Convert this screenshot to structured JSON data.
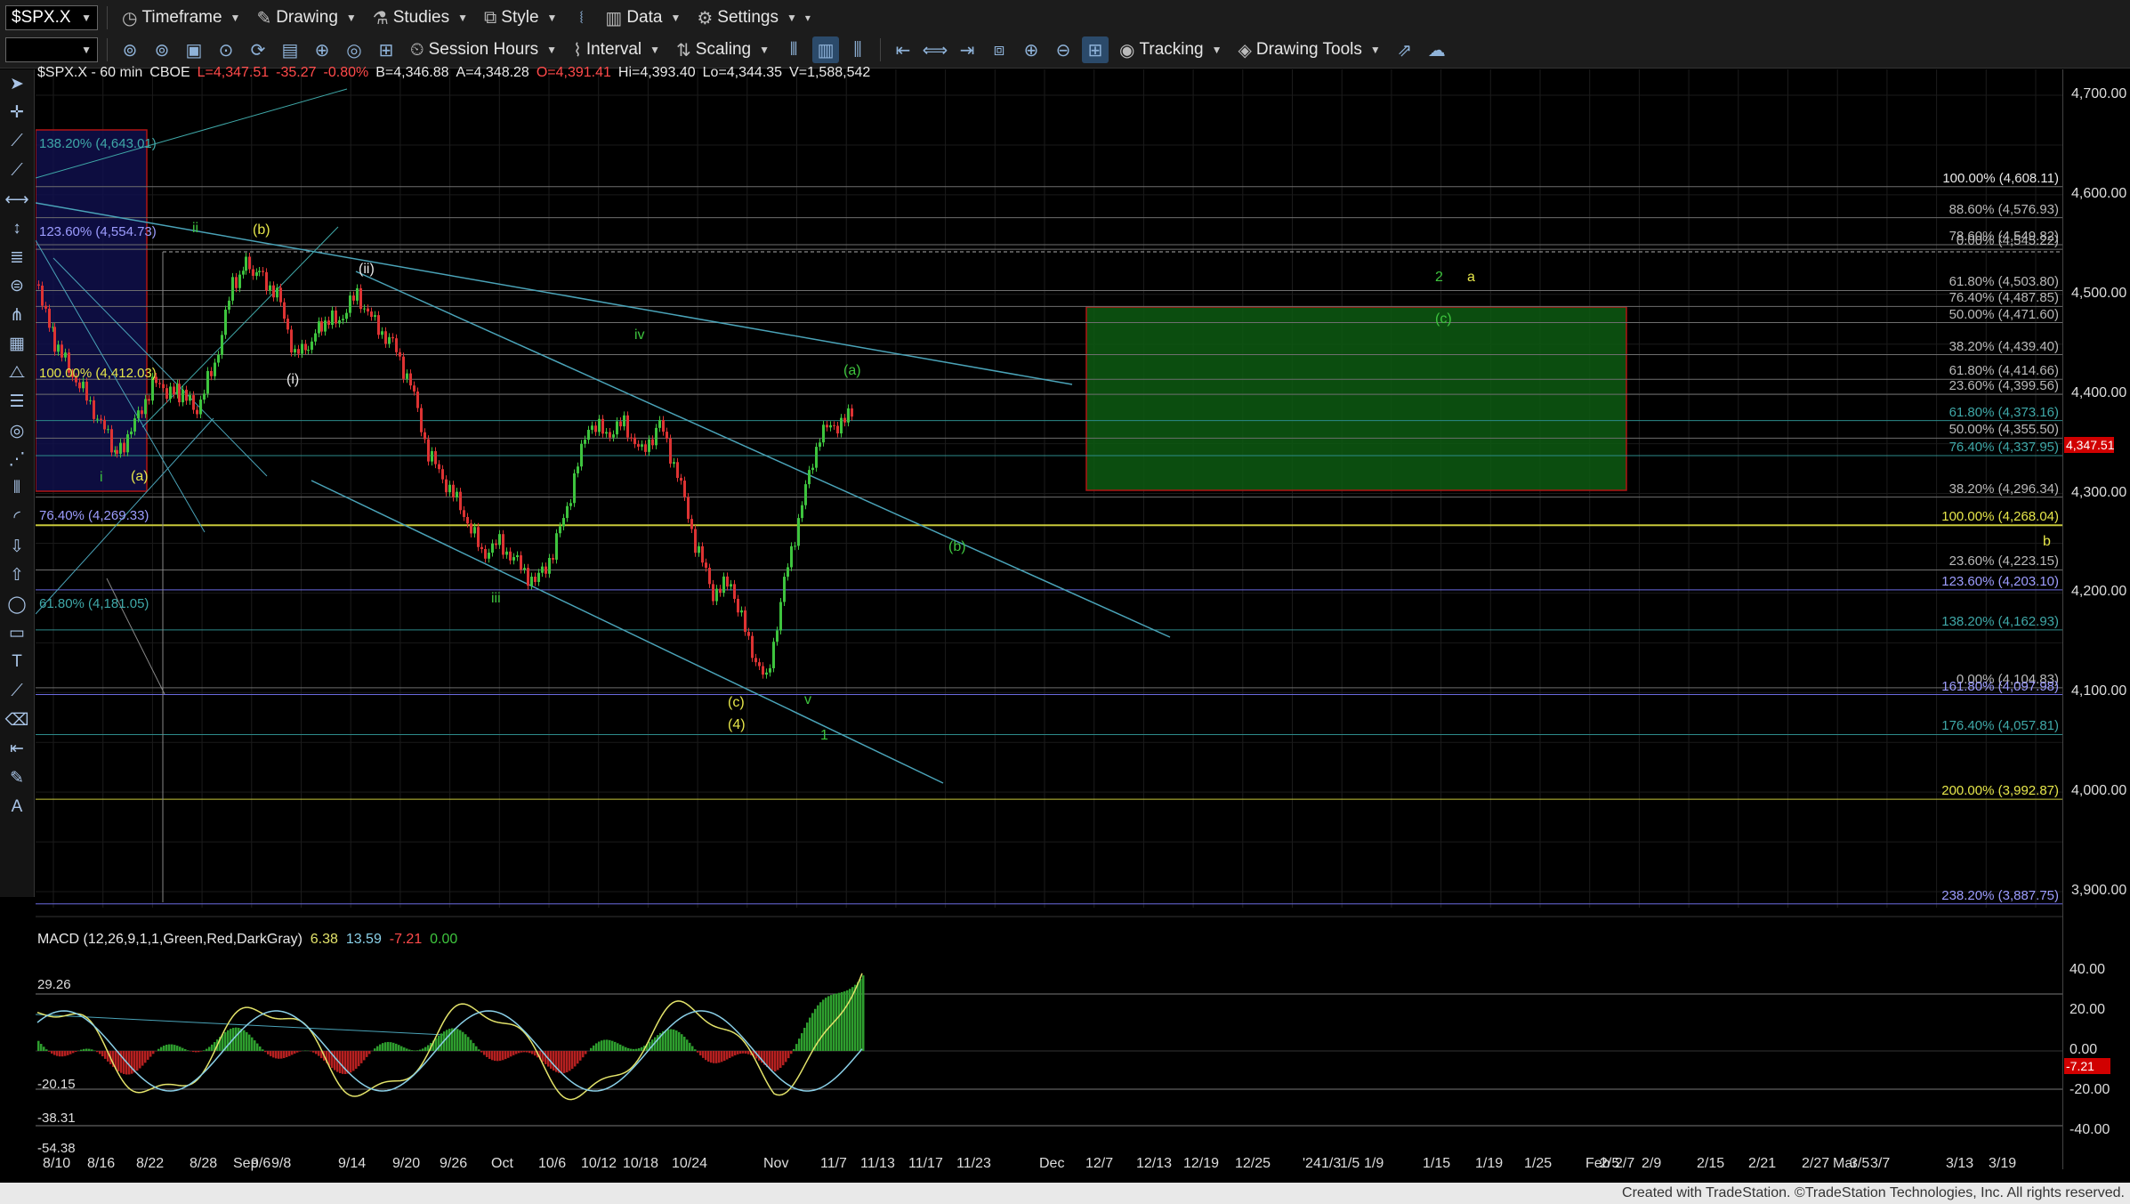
{
  "toolbar": {
    "symbol": "$SPX.X",
    "timeframe_label": "Timeframe",
    "drawing_label": "Drawing",
    "studies_label": "Studies",
    "style_label": "Style",
    "data_label": "Data",
    "settings_label": "Settings",
    "session_hours_label": "Session Hours",
    "interval_label": "Interval",
    "scaling_label": "Scaling",
    "tracking_label": "Tracking",
    "drawing_tools_label": "Drawing Tools"
  },
  "header": {
    "title": "$SPX.X - 60 min",
    "exchange": "CBOE",
    "last": "L=4,347.51",
    "change": "-35.27",
    "pct": "-0.80%",
    "bid": "B=4,346.88",
    "ask": "A=4,348.28",
    "open": "O=4,391.41",
    "high": "Hi=4,393.40",
    "low": "Lo=4,344.35",
    "volume": "V=1,588,542"
  },
  "macd_header": {
    "name": "MACD (12,26,9,1,1,Green,Red,DarkGray)",
    "v1": "6.38",
    "v2": "13.59",
    "v3": "-7.21",
    "v4": "0.00"
  },
  "price_axis": [
    "4,700.00",
    "4,600.00",
    "4,500.00",
    "4,400.00",
    "4,300.00",
    "4,200.00",
    "4,100.00",
    "4,000.00",
    "3,900.00"
  ],
  "last_price_tag": "4,347.51",
  "macd_axis": [
    "40.00",
    "20.00",
    "0.00",
    "-20.00",
    "-40.00"
  ],
  "macd_tag": "-7.21",
  "macd_left_labels": [
    "29.26",
    "-20.15",
    "-38.31",
    "-54.38"
  ],
  "dates": [
    "8/10",
    "8/16",
    "8/22",
    "8/28",
    "Sep",
    "9/6",
    "9/8",
    "9/14",
    "9/20",
    "9/26",
    "Oct",
    "10/6",
    "10/12",
    "10/18",
    "10/24",
    "Nov",
    "11/7",
    "11/13",
    "11/17",
    "11/23",
    "Dec",
    "12/7",
    "12/13",
    "12/19",
    "12/25",
    "'24",
    "1/3",
    "1/5",
    "1/9",
    "1/15",
    "1/19",
    "1/25",
    "Feb",
    "2/5",
    "2/7",
    "2/9",
    "2/15",
    "2/21",
    "2/27",
    "Mar",
    "3/5",
    "3/7",
    "3/13",
    "3/19"
  ],
  "fib_right": [
    {
      "text": "100.00% (4,608.11)",
      "color": "#e8e8e8"
    },
    {
      "text": "88.60% (4,576.93)",
      "color": "#b9b9b9"
    },
    {
      "text": "78.60% (4,549.82)",
      "color": "#b9b9b9"
    },
    {
      "text": "0.00% (4,545.22)",
      "color": "#b9b9b9"
    },
    {
      "text": "61.80% (4,503.80)",
      "color": "#b9b9b9"
    },
    {
      "text": "76.40% (4,487.85)",
      "color": "#b9b9b9"
    },
    {
      "text": "50.00% (4,471.60)",
      "color": "#b9b9b9"
    },
    {
      "text": "38.20% (4,439.40)",
      "color": "#b9b9b9"
    },
    {
      "text": "61.80% (4,414.66)",
      "color": "#b9b9b9"
    },
    {
      "text": "23.60% (4,399.56)",
      "color": "#b9b9b9"
    },
    {
      "text": "61.80% (4,373.16)",
      "color": "#3fa8a8"
    },
    {
      "text": "50.00% (4,355.50)",
      "color": "#b9b9b9"
    },
    {
      "text": "76.40% (4,337.95)",
      "color": "#3fa8a8"
    },
    {
      "text": "38.20% (4,296.34)",
      "color": "#b9b9b9"
    },
    {
      "text": "100.00% (4,268.04)",
      "color": "#e6e64a"
    },
    {
      "text": "23.60% (4,223.15)",
      "color": "#b9b9b9"
    },
    {
      "text": "123.60% (4,203.10)",
      "color": "#9d9dff"
    },
    {
      "text": "138.20% (4,162.93)",
      "color": "#3fa8a8"
    },
    {
      "text": "0.00% (4,104.83)",
      "color": "#b9b9b9"
    },
    {
      "text": "161.80% (4,097.98)",
      "color": "#9d9dff"
    },
    {
      "text": "176.40% (4,057.81)",
      "color": "#3fa8a8"
    },
    {
      "text": "200.00% (3,992.87)",
      "color": "#e6e64a"
    },
    {
      "text": "238.20% (3,887.75)",
      "color": "#9d9dff"
    }
  ],
  "fib_left": [
    {
      "text": "138.20% (4,643.01)",
      "color": "#3fa8a8"
    },
    {
      "text": "123.60% (4,554.73)",
      "color": "#9d9dff"
    },
    {
      "text": "100.00% (4,412.03)",
      "color": "#e6e64a"
    },
    {
      "text": "76.40% (4,269.33)",
      "color": "#9d9dff"
    },
    {
      "text": "61.80% (4,181.05)",
      "color": "#3fa8a8"
    }
  ],
  "waves": [
    {
      "text": "ii",
      "color": "#3ec43e"
    },
    {
      "text": "(b)",
      "color": "#e6e64a"
    },
    {
      "text": "(ii)",
      "color": "#e8e8e8"
    },
    {
      "text": "(i)",
      "color": "#e8e8e8"
    },
    {
      "text": "i",
      "color": "#3ec43e"
    },
    {
      "text": "(a)",
      "color": "#e6e64a"
    },
    {
      "text": "iv",
      "color": "#3ec43e"
    },
    {
      "text": "(a)",
      "color": "#3ec43e"
    },
    {
      "text": "iii",
      "color": "#3ec43e"
    },
    {
      "text": "(b)",
      "color": "#3ec43e"
    },
    {
      "text": "(c)",
      "color": "#e6e64a"
    },
    {
      "text": "(4)",
      "color": "#e6e64a"
    },
    {
      "text": "v",
      "color": "#3ec43e"
    },
    {
      "text": "1",
      "color": "#3ec43e"
    },
    {
      "text": "2",
      "color": "#3ec43e"
    },
    {
      "text": "a",
      "color": "#e6e64a"
    },
    {
      "text": "(c)",
      "color": "#3ec43e"
    },
    {
      "text": "b",
      "color": "#e6e64a"
    }
  ],
  "footer": "Created with TradeStation. ©TradeStation Technologies, Inc. All rights reserved."
}
